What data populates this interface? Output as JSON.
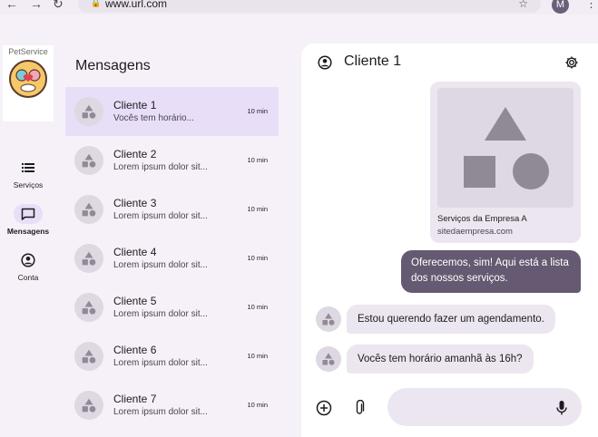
{
  "browser": {
    "url": "www.url.com",
    "profile_initial": "M"
  },
  "logo": {
    "text": "PetService"
  },
  "rail": {
    "items": [
      {
        "label": "Serviços",
        "icon": "list-icon",
        "active": false
      },
      {
        "label": "Mensagens",
        "icon": "chat-icon",
        "active": true
      },
      {
        "label": "Conta",
        "icon": "account-icon",
        "active": false
      }
    ]
  },
  "messages": {
    "title": "Mensagens",
    "items": [
      {
        "name": "Cliente 1",
        "preview": "Vocês tem horário...",
        "time": "10 min"
      },
      {
        "name": "Cliente 2",
        "preview": "Lorem ipsum dolor sit...",
        "time": "10 min"
      },
      {
        "name": "Cliente 3",
        "preview": "Lorem ipsum dolor sit...",
        "time": "10 min"
      },
      {
        "name": "Cliente 4",
        "preview": "Lorem ipsum dolor sit...",
        "time": "10 min"
      },
      {
        "name": "Cliente 5",
        "preview": "Lorem ipsum dolor sit...",
        "time": "10 min"
      },
      {
        "name": "Cliente 6",
        "preview": "Lorem ipsum dolor sit...",
        "time": "10 min"
      },
      {
        "name": "Cliente 7",
        "preview": "Lorem ipsum dolor sit...",
        "time": "10 min"
      }
    ]
  },
  "chat": {
    "title": "Cliente 1",
    "link_card": {
      "title": "Serviços da Empresa A",
      "url": "sitedaempresa.com"
    },
    "outgoing": "Oferecemos, sim! Aqui está a lista dos nossos serviços.",
    "incoming": [
      "Estou querendo fazer um agendamento.",
      "Vocês tem horário amanhã às 16h?"
    ],
    "input_value": ""
  },
  "colors": {
    "accent": "#e8def8",
    "outgoing_bubble": "#655a71",
    "incoming_bubble": "#ece6f0",
    "background": "#f6f1f8"
  }
}
